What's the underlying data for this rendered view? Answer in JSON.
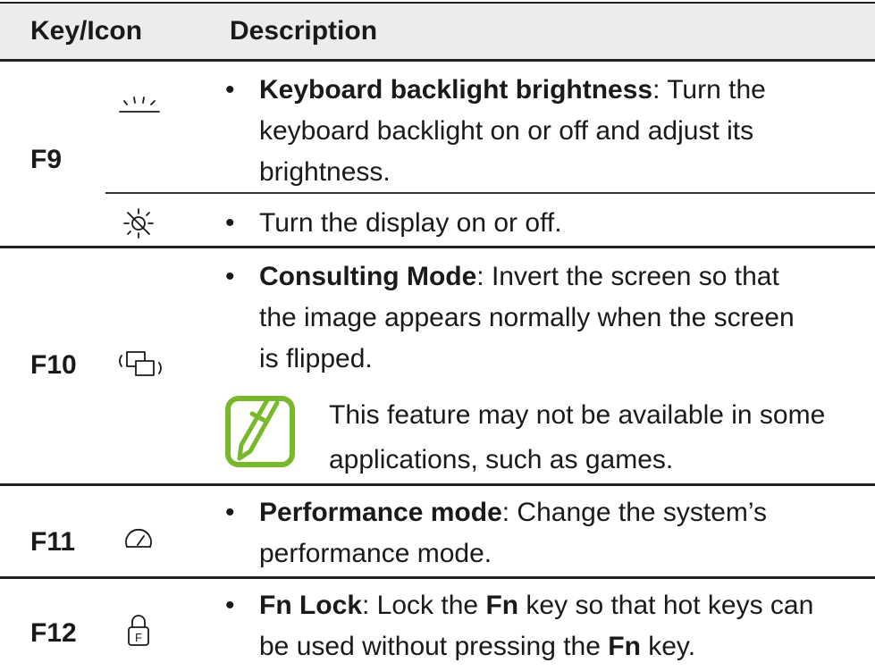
{
  "table": {
    "headers": {
      "key_icon": "Key/Icon",
      "description": "Description"
    },
    "bullet": "•",
    "rows": {
      "f9": {
        "key": "F9",
        "entries": [
          {
            "icon": "keyboard-backlight-icon",
            "title": "Keyboard backlight brightness",
            "line1_rest": ": Turn the",
            "line2": "keyboard backlight on or off and adjust its",
            "line3": "brightness."
          },
          {
            "icon": "display-off-icon",
            "text": "Turn the display on or off."
          }
        ]
      },
      "f10": {
        "key": "F10",
        "icon": "consulting-mode-icon",
        "title": "Consulting Mode",
        "line1_rest": ": Invert the screen so that",
        "line2": "the image appears normally when the screen",
        "line3": "is flipped.",
        "note": {
          "icon": "note-pencil-icon",
          "line1": "This feature may not be available in some",
          "line2": "applications, such as games."
        }
      },
      "f11": {
        "key": "F11",
        "icon": "performance-gauge-icon",
        "title": "Performance mode",
        "line1_rest": ": Change the system’s",
        "line2": "performance mode."
      },
      "f12": {
        "key": "F12",
        "icon": "fn-lock-icon",
        "icon_letter": "F",
        "title": "Fn Lock",
        "line1_a": ": Lock the ",
        "line1_fn": "Fn",
        "line1_b": " key so that hot keys can",
        "line2_a": "be used without pressing the ",
        "line2_fn": "Fn",
        "line2_b": " key."
      }
    }
  },
  "colors": {
    "note_green": "#78b82a",
    "header_bg": "#ececec",
    "rule": "#222222"
  }
}
